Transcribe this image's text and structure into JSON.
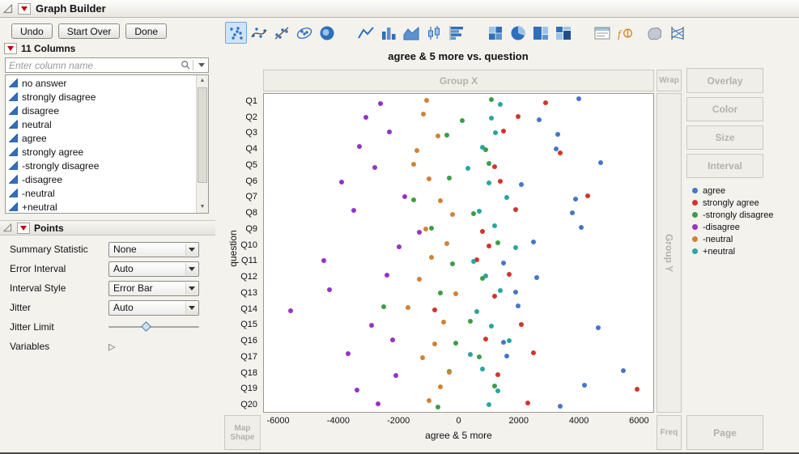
{
  "titlebar": {
    "title": "Graph Builder"
  },
  "toolbar_buttons": {
    "undo": "Undo",
    "start_over": "Start Over",
    "done": "Done"
  },
  "columns_panel": {
    "header": "11 Columns",
    "search_placeholder": "Enter column name",
    "items": [
      "no answer",
      "strongly disagree",
      "disagree",
      "neutral",
      "agree",
      "strongly agree",
      "-strongly disagree",
      "-disagree",
      "-neutral",
      "+neutral"
    ]
  },
  "points_panel": {
    "header": "Points",
    "slider_position": 0.42,
    "rows": [
      {
        "label": "Summary Statistic",
        "value": "None",
        "type": "select"
      },
      {
        "label": "Error Interval",
        "value": "Auto",
        "type": "select"
      },
      {
        "label": "Interval Style",
        "value": "Error Bar",
        "type": "select"
      },
      {
        "label": "Jitter",
        "value": "Auto",
        "type": "select"
      },
      {
        "label": "Jitter Limit",
        "type": "slider"
      },
      {
        "label": "Variables",
        "type": "disclosure"
      }
    ]
  },
  "graph_toolbar": {
    "selected_index": 0,
    "icons": [
      "points",
      "smoother",
      "line-of-fit",
      "ellipse",
      "contour",
      "line",
      "bar",
      "area",
      "box-plot",
      "histogram",
      "heatmap",
      "pie",
      "treemap",
      "mosaic",
      "caption-box",
      "formula",
      "map-shapes",
      "parallel-plot"
    ]
  },
  "chart": {
    "title": "agree & 5 more vs. question"
  },
  "zones": {
    "group_x": "Group X",
    "group_y": "Group Y",
    "wrap": "Wrap",
    "overlay": "Overlay",
    "color": "Color",
    "size": "Size",
    "interval": "Interval",
    "map_shape": "Map Shape",
    "freq": "Freq",
    "page": "Page"
  },
  "chart_data": {
    "type": "scatter",
    "title": "agree & 5 more vs. question",
    "xlabel": "agree & 5 more",
    "ylabel": "question",
    "xlim": [
      -6500,
      6500
    ],
    "x_ticks": [
      -6000,
      -4000,
      -2000,
      0,
      2000,
      4000,
      6000
    ],
    "grid": false,
    "legend_position": "right",
    "categories": [
      "Q1",
      "Q2",
      "Q3",
      "Q4",
      "Q5",
      "Q6",
      "Q7",
      "Q8",
      "Q9",
      "Q10",
      "Q11",
      "Q12",
      "Q13",
      "Q14",
      "Q15",
      "Q16",
      "Q17",
      "Q18",
      "Q19",
      "Q20"
    ],
    "series": [
      {
        "name": "agree",
        "color": "#4576c8",
        "values": [
          4000,
          2700,
          3300,
          3250,
          4750,
          2100,
          3900,
          3800,
          4100,
          2500,
          1500,
          2600,
          1900,
          2000,
          4650,
          1500,
          1600,
          5500,
          4200,
          3400
        ]
      },
      {
        "name": "strongly agree",
        "color": "#d2352c",
        "values": [
          2900,
          2000,
          1500,
          3400,
          1200,
          1400,
          4300,
          1900,
          800,
          1000,
          600,
          1700,
          1200,
          -800,
          2100,
          900,
          2500,
          1300,
          5950,
          2300
        ]
      },
      {
        "name": "-strongly disagree",
        "color": "#3b9e45",
        "values": [
          1100,
          130,
          -400,
          900,
          1000,
          -300,
          -1500,
          500,
          -900,
          1300,
          -200,
          800,
          -600,
          -2500,
          400,
          -100,
          700,
          -300,
          1200,
          -700
        ]
      },
      {
        "name": "-disagree",
        "color": "#9632c8",
        "values": [
          -2600,
          -3100,
          -2300,
          -3300,
          -2800,
          -3900,
          -1800,
          -3500,
          -1300,
          -2000,
          -4500,
          -2400,
          -4300,
          -5600,
          -2900,
          -2200,
          -3700,
          -2100,
          -3400,
          -2700
        ]
      },
      {
        "name": "-neutral",
        "color": "#d28234",
        "values": [
          -1060,
          -1170,
          -700,
          -1400,
          -1500,
          -1000,
          -600,
          -200,
          -1100,
          -400,
          -900,
          -1300,
          -100,
          -1700,
          -500,
          -800,
          -1200,
          -300,
          -600,
          -1000
        ]
      },
      {
        "name": "+neutral",
        "color": "#2aa5a0",
        "values": [
          1400,
          1100,
          1240,
          800,
          300,
          1000,
          1600,
          700,
          1200,
          1900,
          500,
          900,
          1400,
          600,
          1100,
          1700,
          400,
          800,
          1300,
          1000
        ]
      }
    ]
  }
}
